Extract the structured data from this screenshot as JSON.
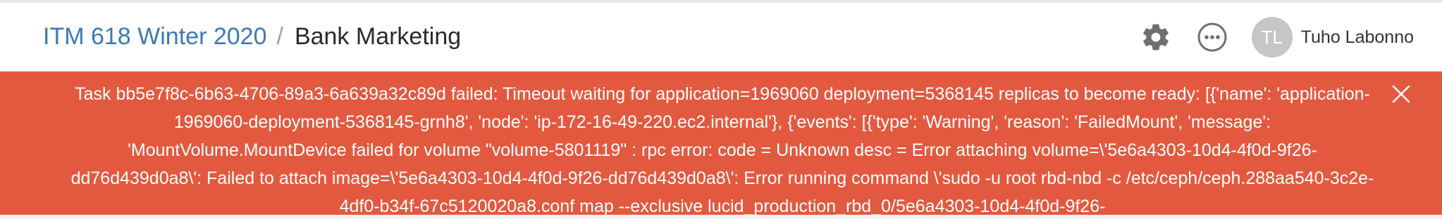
{
  "breadcrumb": {
    "course": "ITM 618 Winter 2020",
    "separator": "/",
    "current": "Bank Marketing"
  },
  "header_actions": {
    "settings_icon": "gear-icon",
    "more_icon": "more-options-icon"
  },
  "user": {
    "initials": "TL",
    "name": "Tuho Labonno"
  },
  "alert": {
    "message": "Task bb5e7f8c-6b63-4706-89a3-6a639a32c89d failed: Timeout waiting for application=1969060 deployment=5368145 replicas to become ready: [{'name': 'application-1969060-deployment-5368145-grnh8', 'node': 'ip-172-16-49-220.ec2.internal'}, {'events': [{'type': 'Warning', 'reason': 'FailedMount', 'message': 'MountVolume.MountDevice failed for volume \"volume-5801119\" : rpc error: code = Unknown desc = Error attaching volume=\\'5e6a4303-10d4-4f0d-9f26-dd76d439d0a8\\': Failed to attach image=\\'5e6a4303-10d4-4f0d-9f26-dd76d439d0a8\\': Error running command \\'sudo -u root rbd-nbd -c /etc/ceph/ceph.288aa540-3c2e-4df0-b34f-67c5120020a8.conf map --exclusive lucid_production_rbd_0/5e6a4303-10d4-4f0d-9f26-",
    "close_icon": "close-icon",
    "color": "#e35940"
  }
}
